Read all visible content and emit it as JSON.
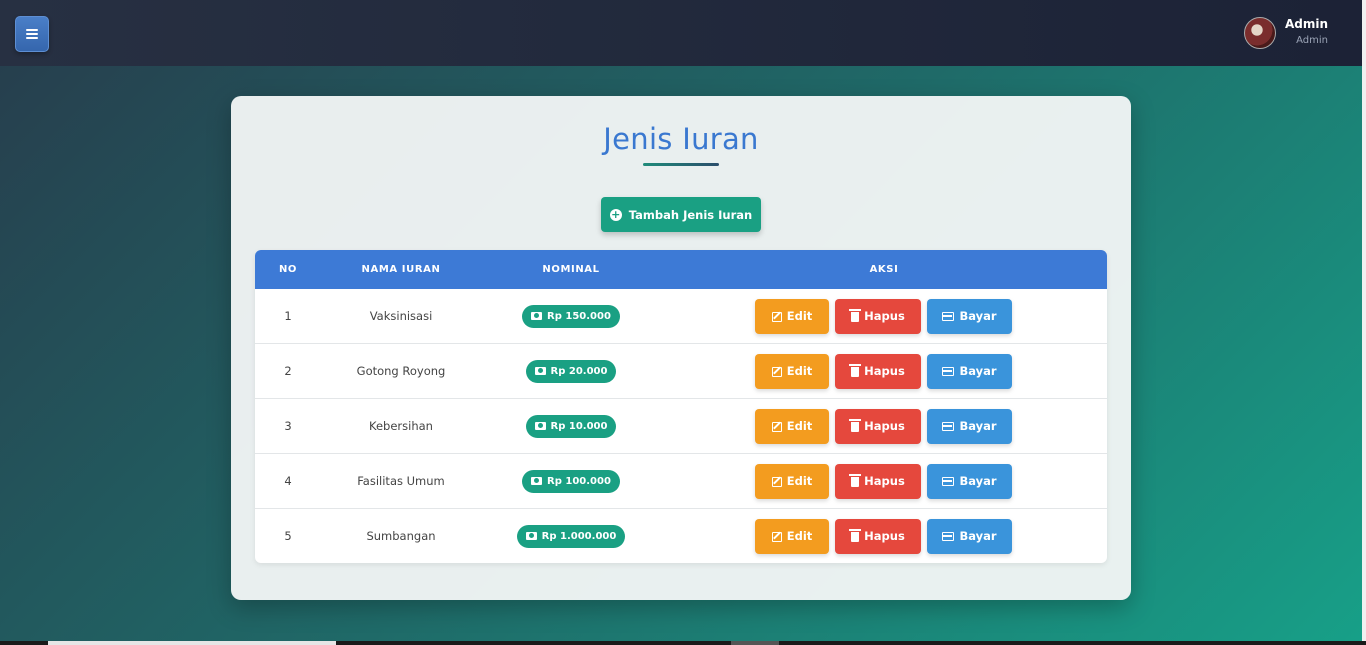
{
  "header": {
    "user_name": "Admin",
    "user_role": "Admin"
  },
  "page": {
    "title": "Jenis Iuran",
    "add_button_label": "Tambah Jenis Iuran"
  },
  "table": {
    "columns": [
      "NO",
      "NAMA IURAN",
      "NOMINAL",
      "AKSI"
    ],
    "rows": [
      {
        "no": "1",
        "nama": "Vaksinisasi",
        "nominal": "Rp 150.000"
      },
      {
        "no": "2",
        "nama": "Gotong Royong",
        "nominal": "Rp 20.000"
      },
      {
        "no": "3",
        "nama": "Kebersihan",
        "nominal": "Rp 10.000"
      },
      {
        "no": "4",
        "nama": "Fasilitas Umum",
        "nominal": "Rp 100.000"
      },
      {
        "no": "5",
        "nama": "Sumbangan",
        "nominal": "Rp 1.000.000"
      }
    ],
    "actions": {
      "edit": "Edit",
      "hapus": "Hapus",
      "bayar": "Bayar"
    }
  },
  "icons": [
    "menu-icon",
    "avatar",
    "plus-circle-icon",
    "money-icon",
    "edit-icon",
    "trash-icon",
    "credit-card-icon"
  ],
  "colors": {
    "accent_blue": "#3d7ad6",
    "teal": "#1aa083",
    "edit": "#f39c1f",
    "hapus": "#e5483d",
    "bayar": "#3a94db"
  }
}
